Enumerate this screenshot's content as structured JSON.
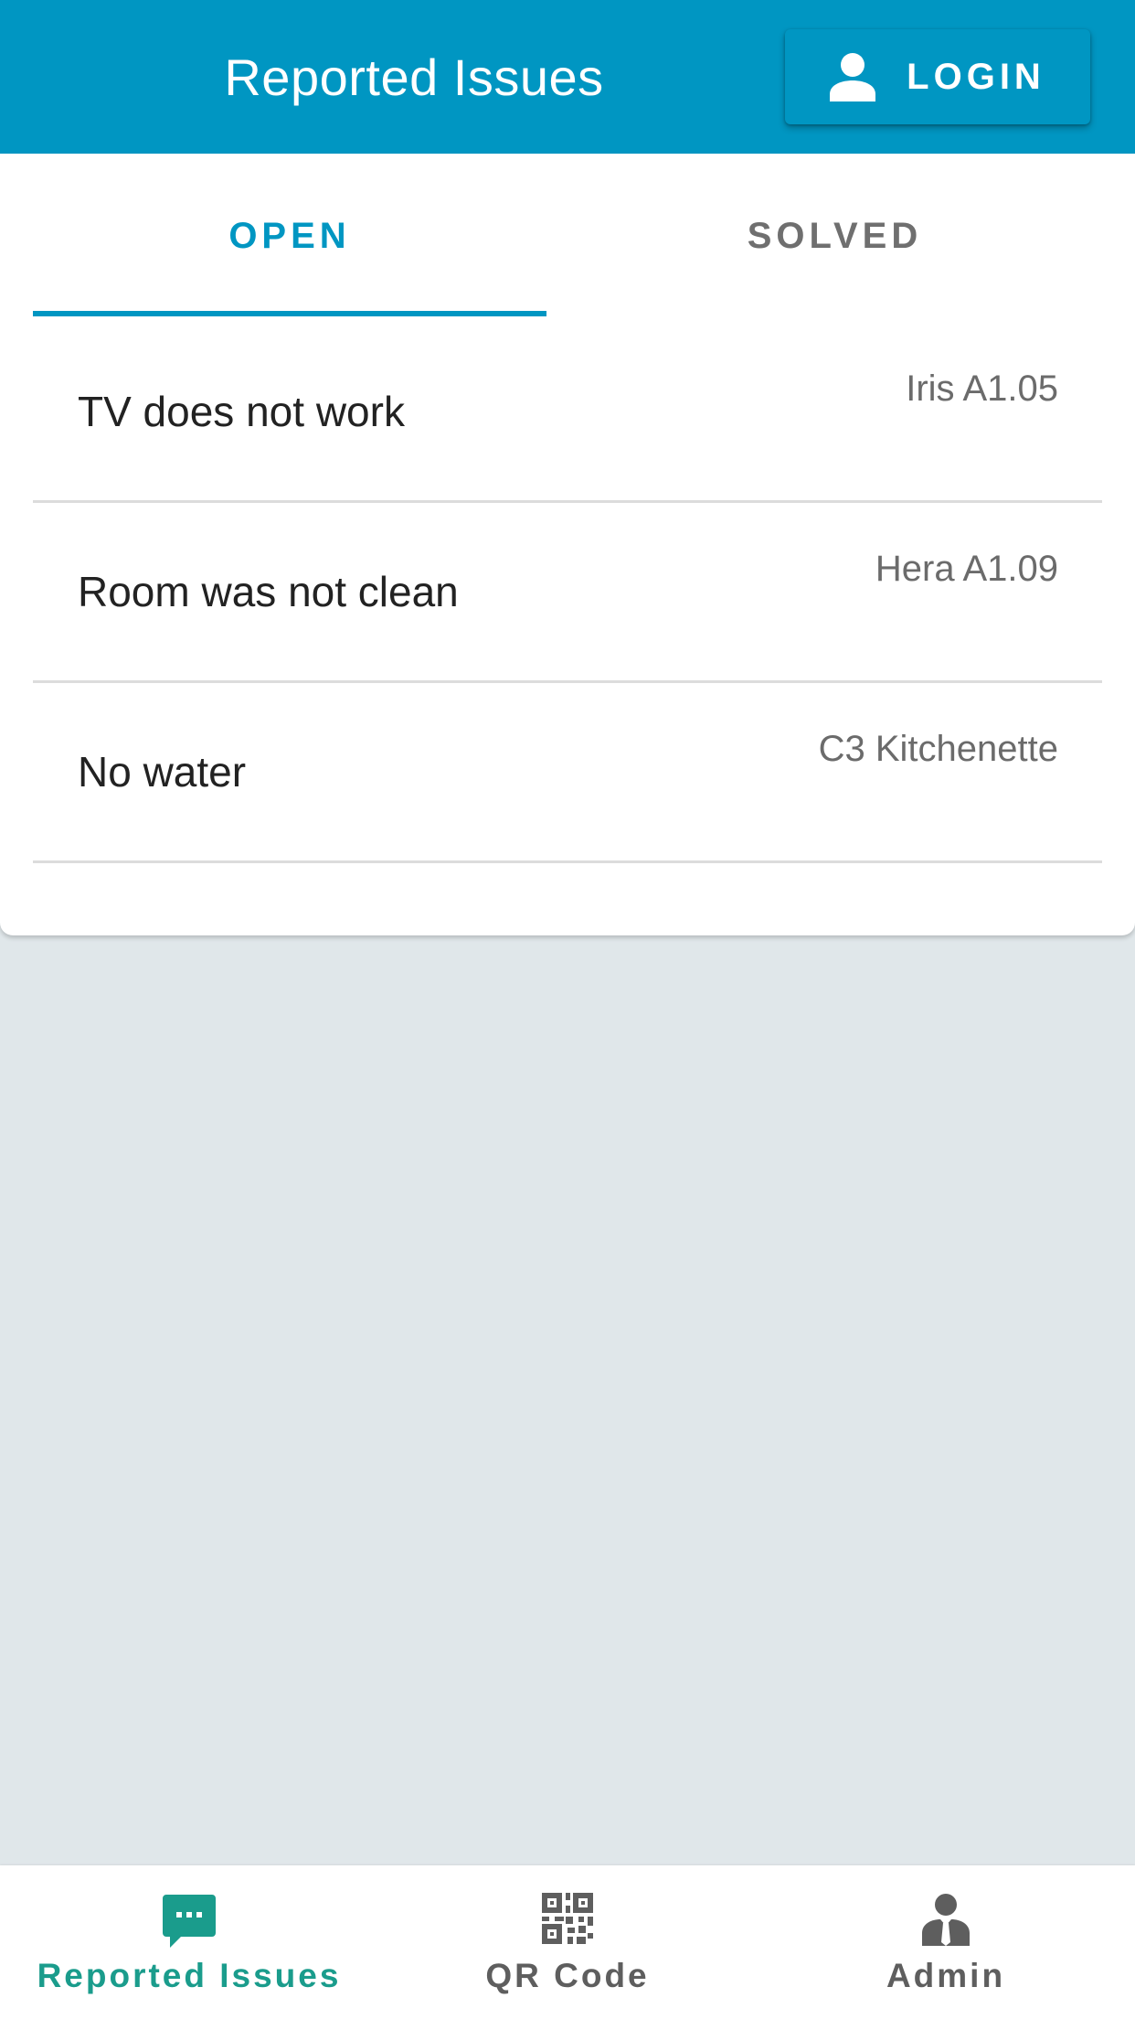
{
  "header": {
    "title": "Reported Issues",
    "login_label": "LOGIN",
    "login_icon": "person-icon",
    "background_color": "#0096c2"
  },
  "tabs": [
    {
      "label": "OPEN",
      "selected": true
    },
    {
      "label": "SOLVED",
      "selected": false
    }
  ],
  "issues": [
    {
      "title": "TV does not work",
      "location": "Iris A1.05"
    },
    {
      "title": "Room was not clean",
      "location": "Hera A1.09"
    },
    {
      "title": "No water",
      "location": "C3 Kitchenette"
    }
  ],
  "bottom_nav": {
    "items": [
      {
        "label": "Reported Issues",
        "icon": "chat-bubble-icon",
        "active": true
      },
      {
        "label": "QR Code",
        "icon": "qr-code-icon",
        "active": false
      },
      {
        "label": "Admin",
        "icon": "admin-person-icon",
        "active": false
      }
    ],
    "active_color": "#1a9c8c"
  }
}
